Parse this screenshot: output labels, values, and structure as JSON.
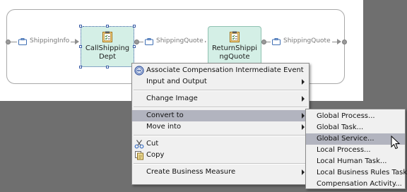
{
  "diagram": {
    "flow_labels": {
      "input": "ShippingInfo",
      "between": "ShippingQuote",
      "output": "ShippingQuote"
    },
    "tasks": {
      "call_shipping": "CallShipping\nDept",
      "return_shipping": "ReturnShippi\nngQuote"
    }
  },
  "context_menu": {
    "items": {
      "associate": "Associate Compensation Intermediate Event",
      "input_output": "Input and Output",
      "change_image": "Change Image",
      "convert_to": "Convert to",
      "move_into": "Move into",
      "cut": "Cut",
      "copy": "Copy",
      "create_measure": "Create Business Measure"
    }
  },
  "convert_submenu": {
    "items": [
      "Global Process...",
      "Global Task...",
      "Global Service...",
      "Local Process...",
      "Local Human Task...",
      "Local Business Rules Task...",
      "Compensation Activity..."
    ],
    "highlighted_index": 2
  },
  "icons": {
    "flow_data": "briefcase-icon",
    "task": "clipboard-icon",
    "associate": "compensation-event-icon",
    "cut": "scissors-icon",
    "copy": "copy-icon",
    "cursor": "mouse-pointer-icon"
  },
  "colors": {
    "canvas": "#ffffff",
    "backdrop": "#6f6f6f",
    "task_fill": "#d4efe6",
    "menu_background": "#f0f0f0",
    "menu_highlight": "#b2b4bf",
    "selection": "#3a5da6"
  }
}
